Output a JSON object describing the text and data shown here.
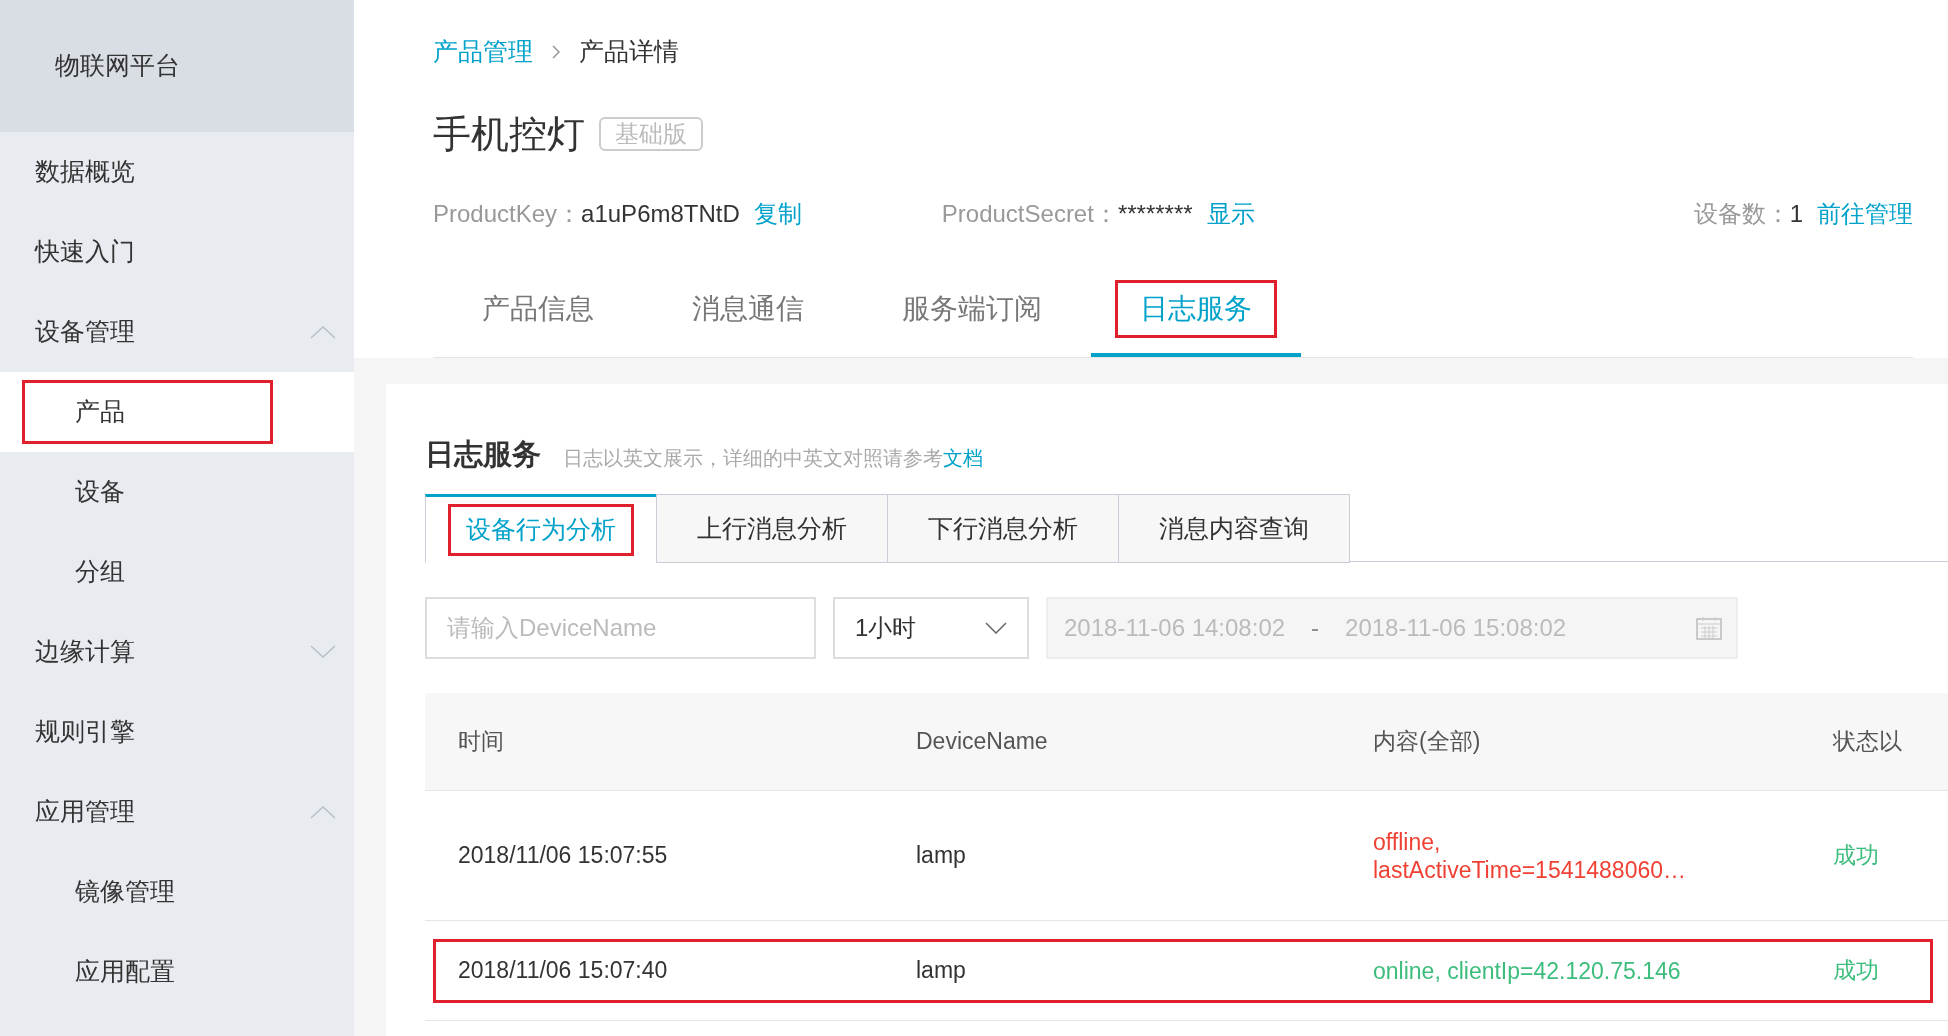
{
  "sidebar": {
    "title": "物联网平台",
    "items": [
      {
        "label": "数据概览",
        "selected": false,
        "highlighted": false
      },
      {
        "label": "快速入门",
        "selected": false,
        "highlighted": false
      },
      {
        "label": "设备管理",
        "selected": false,
        "highlighted": false,
        "expanded": true,
        "children": [
          {
            "label": "产品",
            "selected": true,
            "highlighted": true
          },
          {
            "label": "设备",
            "selected": false,
            "highlighted": false
          },
          {
            "label": "分组",
            "selected": false,
            "highlighted": false
          }
        ]
      },
      {
        "label": "边缘计算",
        "selected": false,
        "highlighted": false,
        "expanded": false
      },
      {
        "label": "规则引擎",
        "selected": false,
        "highlighted": false
      },
      {
        "label": "应用管理",
        "selected": false,
        "highlighted": false,
        "expanded": true,
        "children": [
          {
            "label": "镜像管理",
            "selected": false,
            "highlighted": false
          },
          {
            "label": "应用配置",
            "selected": false,
            "highlighted": false
          }
        ]
      }
    ]
  },
  "breadcrumb": [
    {
      "label": "产品管理",
      "link": true
    },
    {
      "label": "产品详情",
      "link": false
    }
  ],
  "product": {
    "name": "手机控灯",
    "badge": "基础版",
    "key_label": "ProductKey：",
    "key_value": "a1uP6m8TNtD",
    "key_action": "复制",
    "secret_label": "ProductSecret：",
    "secret_value": "********",
    "secret_action": "显示",
    "devices_label": "设备数：",
    "devices_value": "1",
    "devices_action": "前往管理"
  },
  "tabs": [
    {
      "label": "产品信息",
      "selected": false,
      "highlighted": false
    },
    {
      "label": "消息通信",
      "selected": false,
      "highlighted": false
    },
    {
      "label": "服务端订阅",
      "selected": false,
      "highlighted": false
    },
    {
      "label": "日志服务",
      "selected": true,
      "highlighted": true
    }
  ],
  "log_panel": {
    "title": "日志服务",
    "hint": "日志以英文展示，详细的中英文对照请参考",
    "hint_link": "文档",
    "subtabs": [
      {
        "label": "设备行为分析",
        "selected": true,
        "highlighted": true
      },
      {
        "label": "上行消息分析",
        "selected": false,
        "highlighted": false
      },
      {
        "label": "下行消息分析",
        "selected": false,
        "highlighted": false
      },
      {
        "label": "消息内容查询",
        "selected": false,
        "highlighted": false
      }
    ],
    "search": {
      "placeholder": "请输入DeviceName"
    },
    "range_select": {
      "value": "1小时"
    },
    "date_start": "2018-11-06 14:08:02",
    "date_separator": "-",
    "date_end": "2018-11-06 15:08:02",
    "table": {
      "columns": [
        "时间",
        "DeviceName",
        "内容(全部)",
        "状态以"
      ],
      "rows": [
        {
          "time": "2018/11/06 15:07:55",
          "device": "lamp",
          "content": [
            "offline,",
            "lastActiveTime=1541488060…"
          ],
          "color": "#f04134",
          "status": "成功",
          "highlighted": false
        },
        {
          "time": "2018/11/06 15:07:40",
          "device": "lamp",
          "content": [
            "online, clientIp=42.120.75.146"
          ],
          "color": "#3dbd7d",
          "status": "成功",
          "highlighted": true
        }
      ]
    }
  }
}
